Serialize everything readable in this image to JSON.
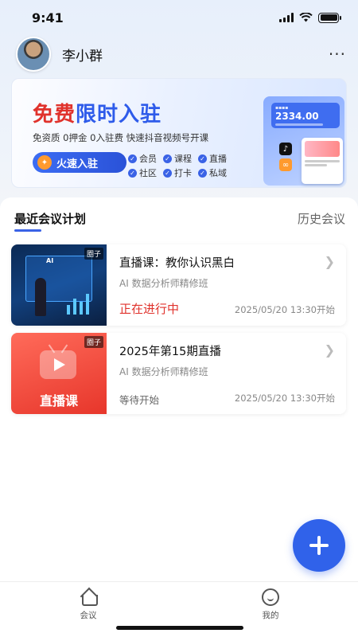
{
  "status_bar": {
    "time": "9:41"
  },
  "profile": {
    "name": "李小群",
    "more": "···"
  },
  "banner": {
    "title_red": "免费",
    "title_blue": "限时入驻",
    "subtitle": "免资质  0押金  0入驻费  快速抖音视频号开课",
    "cta": "火速入驻",
    "features": [
      "会员",
      "课程",
      "直播",
      "社区",
      "打卡",
      "私域"
    ],
    "deco_value": "2334.00"
  },
  "tabs": {
    "active": "最近会议计划",
    "history": "历史会议"
  },
  "meetings": [
    {
      "title": "直播课：教你认识黑白",
      "subtitle": "AI 数据分析师精修班",
      "status": "正在进行中",
      "time": "2025/05/20 13:30开始",
      "badge": "圈子",
      "thumb_text": "AI"
    },
    {
      "title": "2025年第15期直播",
      "subtitle": "AI 数据分析师精修班",
      "status": "等待开始",
      "time": "2025/05/20 13:30开始",
      "badge": "圈子",
      "thumb_label": "直播课"
    }
  ],
  "tabbar": {
    "meeting": "会议",
    "mine": "我的"
  },
  "colors": {
    "accent": "#3062ea",
    "live": "#e0322c"
  }
}
